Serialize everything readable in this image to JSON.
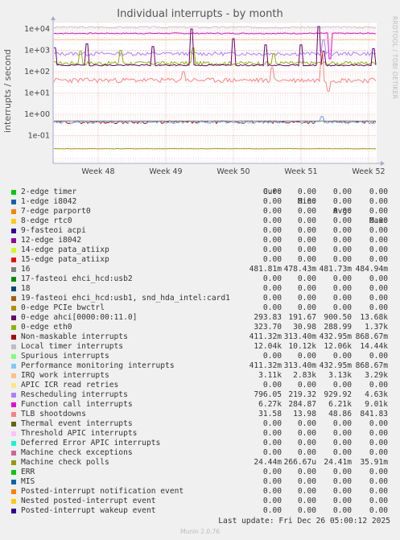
{
  "title": "Individual interrupts - by month",
  "side_label": "RRDTOOL / TOBI OETIKER",
  "footer": "Last update:  Fri Dec 26 05:00:12 2025",
  "munin": "Munin 2.0.76",
  "headers": {
    "cur": "Cur:",
    "min": "Min:",
    "avg": "Avg:",
    "max": "Max:"
  },
  "chart_data": {
    "type": "line",
    "title": "Individual interrupts - by month",
    "ylabel": "interrupts / second",
    "yscale": "log",
    "ylim": [
      0.005,
      20000
    ],
    "yticks": [
      "1e-01",
      "1e+00",
      "1e+01",
      "1e+02",
      "1e+03",
      "1e+04"
    ],
    "xticks": [
      "Week 48",
      "Week 49",
      "Week 50",
      "Week 51",
      "Week 52"
    ],
    "grid": true,
    "series": [
      {
        "name": "2-edge timer",
        "color": "#00cc00",
        "cur": "0.00",
        "min": "0.00",
        "avg": "0.00",
        "max": "0.00"
      },
      {
        "name": "1-edge i8042",
        "color": "#0066b3",
        "cur": "0.00",
        "min": "0.00",
        "avg": "0.00",
        "max": "0.00"
      },
      {
        "name": "7-edge parport0",
        "color": "#ff8000",
        "cur": "0.00",
        "min": "0.00",
        "avg": "0.00",
        "max": "0.00"
      },
      {
        "name": "8-edge rtc0",
        "color": "#ffcc00",
        "cur": "0.00",
        "min": "0.00",
        "avg": "0.00",
        "max": "0.00"
      },
      {
        "name": "9-fasteoi acpi",
        "color": "#330099",
        "cur": "0.00",
        "min": "0.00",
        "avg": "0.00",
        "max": "0.00"
      },
      {
        "name": "12-edge i8042",
        "color": "#990099",
        "cur": "0.00",
        "min": "0.00",
        "avg": "0.00",
        "max": "0.00"
      },
      {
        "name": "14-edge pata_atiixp",
        "color": "#ccff00",
        "cur": "0.00",
        "min": "0.00",
        "avg": "0.00",
        "max": "0.00"
      },
      {
        "name": "15-edge pata_atiixp",
        "color": "#ff0000",
        "cur": "0.00",
        "min": "0.00",
        "avg": "0.00",
        "max": "0.00"
      },
      {
        "name": "16",
        "color": "#808080",
        "cur": "481.81m",
        "min": "478.43m",
        "avg": "481.73m",
        "max": "484.94m"
      },
      {
        "name": "17-fasteoi ehci_hcd:usb2",
        "color": "#008f00",
        "cur": "0.00",
        "min": "0.00",
        "avg": "0.00",
        "max": "0.00"
      },
      {
        "name": "18",
        "color": "#00487d",
        "cur": "0.00",
        "min": "0.00",
        "avg": "0.00",
        "max": "0.00"
      },
      {
        "name": "19-fasteoi ehci_hcd:usb1, snd_hda_intel:card1",
        "color": "#b35a00",
        "cur": "0.00",
        "min": "0.00",
        "avg": "0.00",
        "max": "0.00"
      },
      {
        "name": "0-edge PCIe bwctrl",
        "color": "#b38f00",
        "cur": "0.00",
        "min": "0.00",
        "avg": "0.00",
        "max": "0.00"
      },
      {
        "name": "0-edge ahci[0000:00:11.0]",
        "color": "#6b006b",
        "cur": "293.83",
        "min": "191.67",
        "avg": "900.50",
        "max": "13.68k"
      },
      {
        "name": "0-edge eth0",
        "color": "#8fb300",
        "cur": "323.70",
        "min": "30.98",
        "avg": "288.99",
        "max": "1.37k"
      },
      {
        "name": "Non-maskable interrupts",
        "color": "#b30000",
        "cur": "411.32m",
        "min": "313.40m",
        "avg": "432.95m",
        "max": "868.67m"
      },
      {
        "name": "Local timer interrupts",
        "color": "#bebebe",
        "cur": "12.04k",
        "min": "10.12k",
        "avg": "12.06k",
        "max": "14.44k"
      },
      {
        "name": "Spurious interrupts",
        "color": "#80ff80",
        "cur": "0.00",
        "min": "0.00",
        "avg": "0.00",
        "max": "0.00"
      },
      {
        "name": "Performance monitoring interrupts",
        "color": "#80c9ff",
        "cur": "411.32m",
        "min": "313.40m",
        "avg": "432.95m",
        "max": "868.67m"
      },
      {
        "name": "IRQ work interrupts",
        "color": "#ffc080",
        "cur": "3.11k",
        "min": "2.83k",
        "avg": "3.13k",
        "max": "3.29k"
      },
      {
        "name": "APIC ICR read retries",
        "color": "#ffe680",
        "cur": "0.00",
        "min": "0.00",
        "avg": "0.00",
        "max": "0.00"
      },
      {
        "name": "Rescheduling interrupts",
        "color": "#aa80ff",
        "cur": "796.05",
        "min": "219.32",
        "avg": "929.92",
        "max": "4.63k"
      },
      {
        "name": "Function call interrupts",
        "color": "#ee00cc",
        "cur": "6.27k",
        "min": "284.87",
        "avg": "6.21k",
        "max": "9.01k"
      },
      {
        "name": "TLB shootdowns",
        "color": "#ff8080",
        "cur": "31.58",
        "min": "13.98",
        "avg": "48.86",
        "max": "841.83"
      },
      {
        "name": "Thermal event interrupts",
        "color": "#666600",
        "cur": "0.00",
        "min": "0.00",
        "avg": "0.00",
        "max": "0.00"
      },
      {
        "name": "Threshold APIC interrupts",
        "color": "#ffbfff",
        "cur": "0.00",
        "min": "0.00",
        "avg": "0.00",
        "max": "0.00"
      },
      {
        "name": "Deferred Error APIC interrupts",
        "color": "#00ffcc",
        "cur": "0.00",
        "min": "0.00",
        "avg": "0.00",
        "max": "0.00"
      },
      {
        "name": "Machine check exceptions",
        "color": "#cc6699",
        "cur": "0.00",
        "min": "0.00",
        "avg": "0.00",
        "max": "0.00"
      },
      {
        "name": "Machine check polls",
        "color": "#999900",
        "cur": "24.44m",
        "min": "266.67u",
        "avg": "24.41m",
        "max": "35.91m"
      },
      {
        "name": "ERR",
        "color": "#00cc00",
        "cur": "0.00",
        "min": "0.00",
        "avg": "0.00",
        "max": "0.00"
      },
      {
        "name": "MIS",
        "color": "#0066b3",
        "cur": "0.00",
        "min": "0.00",
        "avg": "0.00",
        "max": "0.00"
      },
      {
        "name": "Posted-interrupt notification event",
        "color": "#ff8000",
        "cur": "0.00",
        "min": "0.00",
        "avg": "0.00",
        "max": "0.00"
      },
      {
        "name": "Nested posted-interrupt event",
        "color": "#ffcc00",
        "cur": "0.00",
        "min": "0.00",
        "avg": "0.00",
        "max": "0.00"
      },
      {
        "name": "Posted-interrupt wakeup event",
        "color": "#330099",
        "cur": "0.00",
        "min": "0.00",
        "avg": "0.00",
        "max": "0.00"
      }
    ]
  }
}
